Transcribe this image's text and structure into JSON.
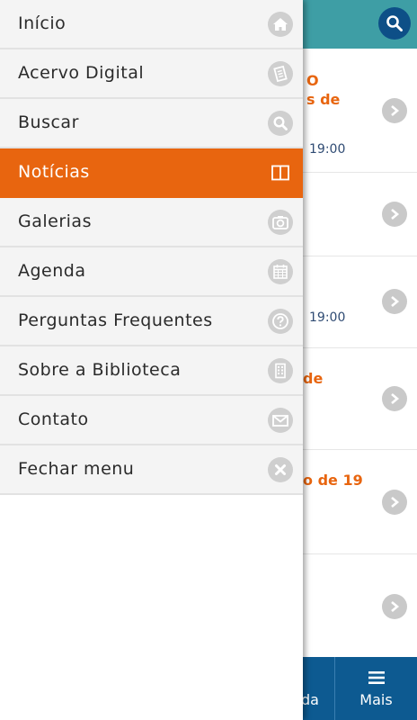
{
  "header": {
    "search_icon": "search-icon"
  },
  "background_list": [
    {
      "title_lines": [
        "O",
        "s de"
      ],
      "date": "19:00"
    },
    {
      "title_lines": [],
      "date": ""
    },
    {
      "title_lines": [],
      "date": "19:00"
    },
    {
      "title_lines": [
        "de"
      ],
      "date": ""
    },
    {
      "title_lines": [
        "o de 19"
      ],
      "date": ""
    },
    {
      "title_lines": [],
      "date": ""
    }
  ],
  "bottom_bar": {
    "tab_agenda_label": "da",
    "tab_mais_label": "Mais"
  },
  "menu": {
    "items": [
      {
        "label": "Início",
        "icon": "home-icon"
      },
      {
        "label": "Acervo Digital",
        "icon": "book-icon"
      },
      {
        "label": "Buscar",
        "icon": "search-icon"
      },
      {
        "label": "Notícias",
        "icon": "newspaper-icon",
        "active": true
      },
      {
        "label": "Galerias",
        "icon": "camera-icon"
      },
      {
        "label": "Agenda",
        "icon": "calendar-icon"
      },
      {
        "label": "Perguntas Frequentes",
        "icon": "question-icon"
      },
      {
        "label": "Sobre a Biblioteca",
        "icon": "building-icon"
      },
      {
        "label": "Contato",
        "icon": "mail-icon"
      },
      {
        "label": "Fechar menu",
        "icon": "close-icon"
      }
    ]
  },
  "colors": {
    "accent": "#e8650f",
    "header": "#3e9ea5",
    "bottom_bar": "#0d5a91"
  }
}
